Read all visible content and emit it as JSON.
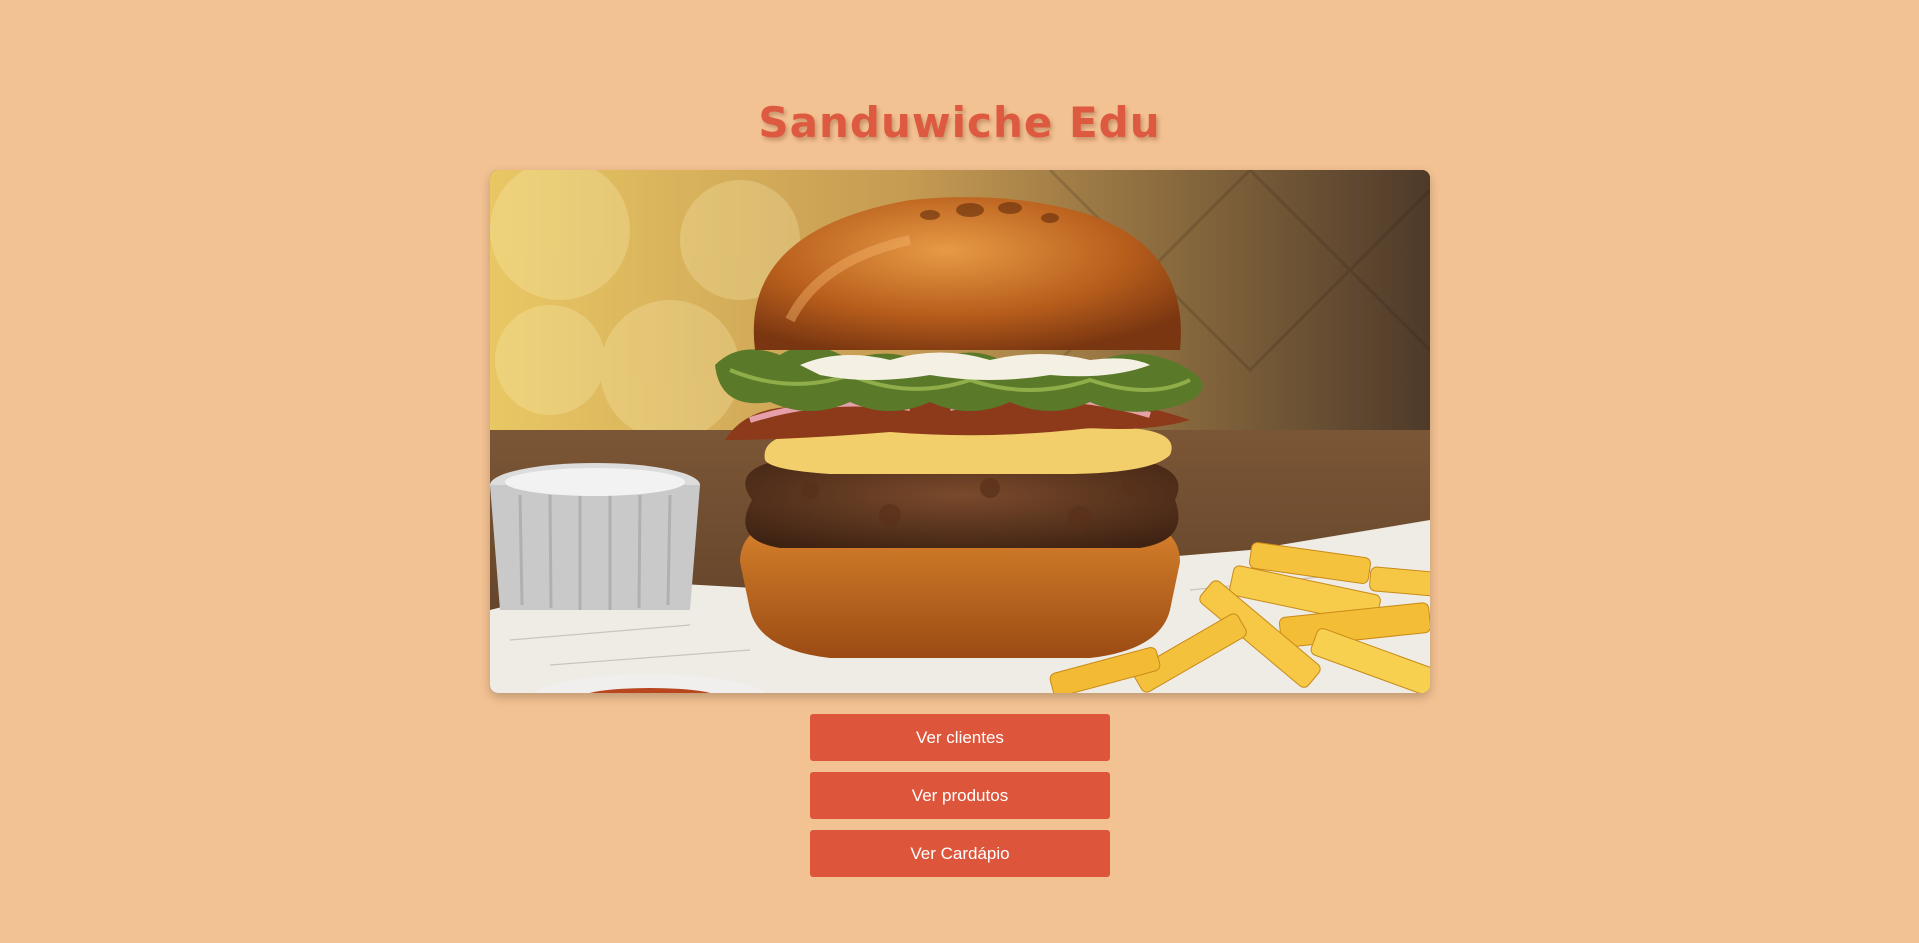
{
  "page": {
    "title": "Sanduwiche Edu"
  },
  "hero_image": {
    "subject": "burger-with-fries-photo"
  },
  "actions": {
    "ver_clientes": "Ver clientes",
    "ver_produtos": "Ver produtos",
    "ver_cardapio": "Ver Cardápio"
  },
  "colors": {
    "background": "#f3c293",
    "accent": "#dd563c",
    "button_text": "#ffffff"
  }
}
